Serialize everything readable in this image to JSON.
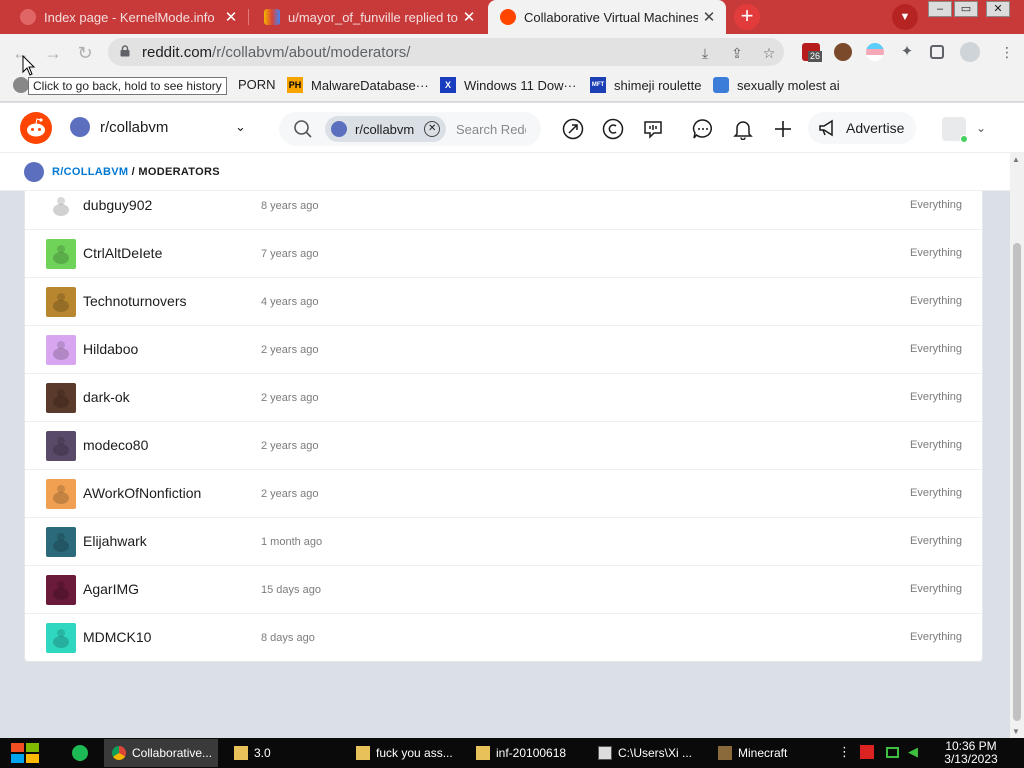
{
  "browser": {
    "tabs": [
      {
        "title": "Index page - KernelMode.info",
        "close": "✕"
      },
      {
        "title": "u/mayor_of_funville replied to y",
        "close": "✕"
      },
      {
        "title": "Collaborative Virtual Machines!",
        "close": "✕"
      }
    ],
    "new_tab": "+",
    "window_controls": [
      "–",
      "▭",
      "✕"
    ],
    "url_host": "reddit.com",
    "url_path": "/r/collabvm/about/moderators/",
    "tooltip": "Click to go back, hold to see history",
    "extension_badge": "26",
    "bookmarks": [
      {
        "label": "PORN",
        "icon_text": ""
      },
      {
        "label": "MalwareDatabase···",
        "icon_text": "PH"
      },
      {
        "label": "Windows 11 Dow···",
        "icon_text": "X"
      },
      {
        "label": "shimeji roulette",
        "icon_text": "MFT"
      },
      {
        "label": "sexually molest ai",
        "icon_text": ""
      }
    ]
  },
  "reddit": {
    "community": "r/collabvm",
    "search_chip": "r/collabvm",
    "search_placeholder": "Search Reddit",
    "advertise": "Advertise",
    "breadcrumb": {
      "community": "R/COLLABVM",
      "separator": " / ",
      "page": "MODERATORS"
    },
    "moderators": [
      {
        "name": "dubguy902",
        "since": "8 years ago",
        "permissions": "Everything",
        "avatar_color": "#ffffff"
      },
      {
        "name": "CtrlAltDeIete",
        "since": "7 years ago",
        "permissions": "Everything",
        "avatar_color": "#6fd35a"
      },
      {
        "name": "Technoturnovers",
        "since": "4 years ago",
        "permissions": "Everything",
        "avatar_color": "#b8862f"
      },
      {
        "name": "Hildaboo",
        "since": "2 years ago",
        "permissions": "Everything",
        "avatar_color": "#d8a6f0"
      },
      {
        "name": "dark-ok",
        "since": "2 years ago",
        "permissions": "Everything",
        "avatar_color": "#5a3a2a"
      },
      {
        "name": "modeco80",
        "since": "2 years ago",
        "permissions": "Everything",
        "avatar_color": "#5a4a6a"
      },
      {
        "name": "AWorkOfNonfiction",
        "since": "2 years ago",
        "permissions": "Everything",
        "avatar_color": "#f0a050"
      },
      {
        "name": "Elijahwark",
        "since": "1 month ago",
        "permissions": "Everything",
        "avatar_color": "#2b6a7a"
      },
      {
        "name": "AgarIMG",
        "since": "15 days ago",
        "permissions": "Everything",
        "avatar_color": "#6a1a3a"
      },
      {
        "name": "MDMCK10",
        "since": "8 days ago",
        "permissions": "Everything",
        "avatar_color": "#2fd6c0"
      }
    ]
  },
  "taskbar": {
    "items": [
      {
        "label": "Collaborative..."
      },
      {
        "label": "3.0"
      },
      {
        "label": "fuck you ass..."
      },
      {
        "label": "inf-20100618"
      },
      {
        "label": "C:\\Users\\Xi ..."
      },
      {
        "label": "Minecraft"
      }
    ],
    "time": "10:36 PM",
    "date": "3/13/2023"
  },
  "colors": {
    "tabbar": "#c83a3a",
    "reddit_orange": "#ff4500",
    "link_blue": "#0079d3"
  }
}
